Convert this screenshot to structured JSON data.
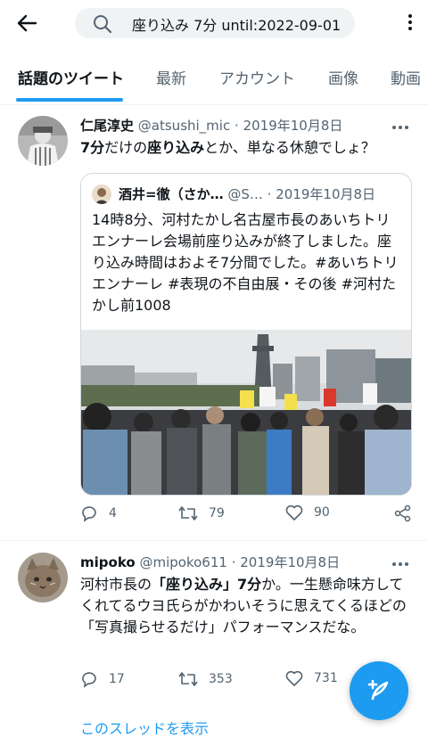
{
  "search": {
    "query": "座り込み 7分 until:2022-09-01"
  },
  "tabs": [
    {
      "label": "話題のツイート",
      "active": true
    },
    {
      "label": "最新"
    },
    {
      "label": "アカウント"
    },
    {
      "label": "画像"
    },
    {
      "label": "動画"
    }
  ],
  "tweets": [
    {
      "name": "仁尾淳史",
      "handle": "@atsushi_mic",
      "date": "2019年10月8日",
      "text_parts": [
        {
          "t": "7分",
          "b": true
        },
        {
          "t": "だけの",
          "b": false
        },
        {
          "t": "座り込み",
          "b": true
        },
        {
          "t": "とか、単なる休憩でしょ？",
          "b": false
        }
      ],
      "quote": {
        "name": "酒井=徹（さか…",
        "handle": "@S…",
        "date": "2019年10月8日",
        "text": "14時8分、河村たかし名古屋市長のあいちトリエンナーレ会場前座り込みが終了しました。座り込み時間はおよそ7分間でした。#あいちトリエンナーレ #表現の不自由展・その後 #河村たかし前1008"
      },
      "stats": {
        "replies": "4",
        "retweets": "79",
        "likes": "90"
      }
    },
    {
      "name": "mipoko",
      "handle": "@mipoko611",
      "date": "2019年10月8日",
      "text_parts": [
        {
          "t": "河村市長の",
          "b": false
        },
        {
          "t": "「座り込み」7分",
          "b": true
        },
        {
          "t": "か。一生懸命味方してくれてるウヨ氏らがかわいそうに思えてくるほどの「写真撮らせるだけ」パフォーマンスだな。",
          "b": false
        }
      ],
      "stats": {
        "replies": "17",
        "retweets": "353",
        "likes": "731"
      }
    }
  ],
  "thread_link": "このスレッドを表示",
  "colors": {
    "accent": "#1d9bf0",
    "text": "#0f1419",
    "muted": "#536471"
  },
  "icons": [
    "back-arrow-icon",
    "search-icon",
    "more-vertical-icon",
    "reply-icon",
    "retweet-icon",
    "like-icon",
    "share-icon",
    "compose-icon"
  ]
}
